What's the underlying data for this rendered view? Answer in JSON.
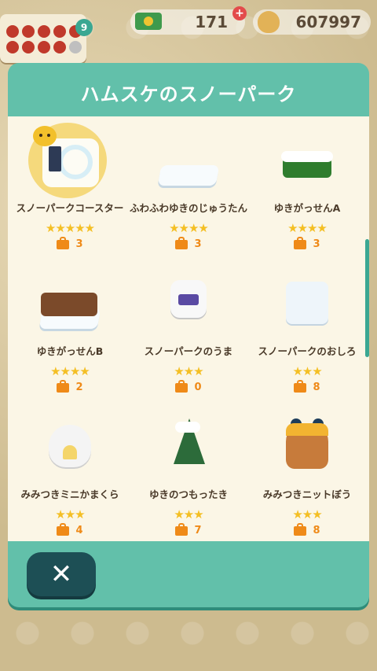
{
  "hud": {
    "ticket_badge": "9",
    "leaf_tickets": "171",
    "bells": "607997"
  },
  "modal": {
    "title": "ハムスケのスノーパーク"
  },
  "items": [
    {
      "name": "スノーパークコースター",
      "stars": "★★★★★",
      "count": "3",
      "icon": "snow-park-coaster-icon"
    },
    {
      "name": "ふわふわゆきのじゅうたん",
      "stars": "★★★★",
      "count": "3",
      "icon": "snow-rug-icon"
    },
    {
      "name": "ゆきがっせんA",
      "stars": "★★★★",
      "count": "3",
      "icon": "snowball-fight-a-icon"
    },
    {
      "name": "ゆきがっせんB",
      "stars": "★★★★",
      "count": "2",
      "icon": "snowball-fight-b-icon"
    },
    {
      "name": "スノーパークのうま",
      "stars": "★★★",
      "count": "0",
      "icon": "snow-park-horse-icon"
    },
    {
      "name": "スノーパークのおしろ",
      "stars": "★★★",
      "count": "8",
      "icon": "snow-park-castle-icon"
    },
    {
      "name": "みみつきミニかまくら",
      "stars": "★★★",
      "count": "4",
      "icon": "eared-mini-igloo-icon"
    },
    {
      "name": "ゆきのつもったき",
      "stars": "★★★",
      "count": "7",
      "icon": "snowy-tree-icon"
    },
    {
      "name": "みみつきニットぼう",
      "stars": "★★★",
      "count": "8",
      "icon": "eared-knit-hat-icon"
    }
  ],
  "close_label": "✕"
}
